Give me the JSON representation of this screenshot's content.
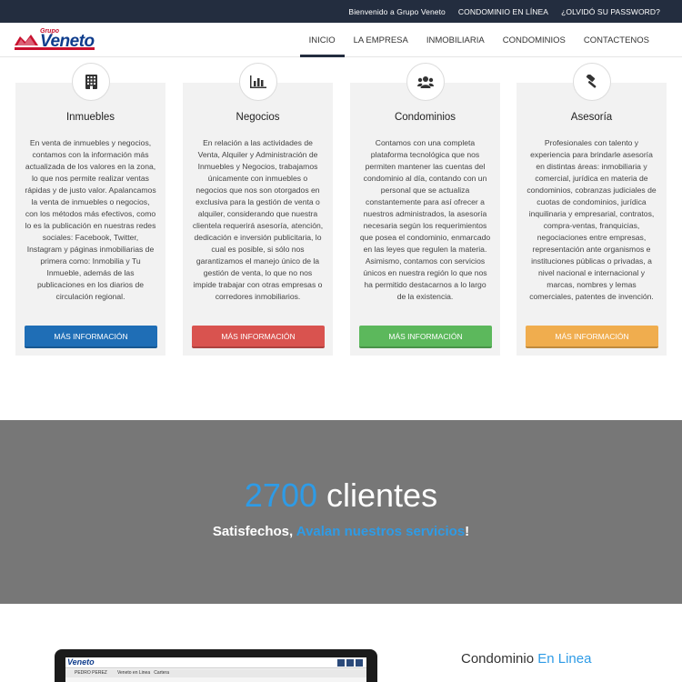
{
  "topbar": {
    "welcome": "Bienvenido a Grupo Veneto",
    "condominio": "CONDOMINIO EN LÍNEA",
    "forgot": "¿OLVIDÓ SU PASSWORD?"
  },
  "logo": {
    "small": "Grupo",
    "brand": "Veneto"
  },
  "nav": [
    {
      "label": "INICIO",
      "active": true
    },
    {
      "label": "LA EMPRESA"
    },
    {
      "label": "INMOBILIARIA"
    },
    {
      "label": "CONDOMINIOS"
    },
    {
      "label": "CONTACTENOS"
    }
  ],
  "cards": [
    {
      "icon": "building-icon",
      "title": "Inmuebles",
      "text": "En venta de inmuebles y negocios, contamos con la información más actualizada de los valores en la zona, lo que nos permite realizar ventas rápidas y de justo valor. Apalancamos la venta de inmuebles o negocios, con los métodos más efectivos, como lo es la publicación en nuestras redes sociales: Facebook, Twitter, Instagram y páginas inmobiliarias de primera como: Inmobilia y Tu Inmueble, además de las publicaciones en los diarios de circulación regional.",
      "button": "MÁS INFORMACIÓN",
      "color": "#1f6eb6"
    },
    {
      "icon": "bar-chart-icon",
      "title": "Negocios",
      "text": "En relación a las actividades de Venta, Alquiler y Administración de Inmuebles y Negocios, trabajamos únicamente con inmuebles o negocios que nos son otorgados en exclusiva para la gestión de venta o alquiler, considerando que nuestra clientela requerirá asesoría, atención, dedicación e inversión publicitaria, lo cual es posible, si sólo nos garantizamos el manejo único de la gestión de venta, lo que no nos impide trabajar con otras empresas o corredores inmobiliarios.",
      "button": "MÁS INFORMACIÓN",
      "color": "#d9534f"
    },
    {
      "icon": "users-icon",
      "title": "Condominios",
      "text": "Contamos con una completa plataforma tecnológica que nos permiten mantener las cuentas del condominio al día, contando con un personal que se actualiza constantemente para así ofrecer a nuestros administrados, la asesoría necesaria según los requerimientos que posea el condominio, enmarcado en las leyes que regulen la materia. Asimismo, contamos con servicios únicos en nuestra región lo que nos ha permitido destacarnos a lo largo de la existencia.",
      "button": "MÁS INFORMACIÓN",
      "color": "#5cb85c"
    },
    {
      "icon": "gavel-icon",
      "title": "Asesoría",
      "text": "Profesionales con talento y experiencia para brindarle asesoría en distintas áreas: inmobiliaria y comercial, jurídica en materia de condominios, cobranzas judiciales de cuotas de condominios, jurídica inquilinaria y empresarial, contratos, compra-ventas, franquicias, negociaciones entre empresas, representación ante organismos e instituciones públicas o privadas, a nivel nacional e internacional y marcas, nombres y lemas comerciales, patentes de invención.",
      "button": "MÁS INFORMACIÓN",
      "color": "#f0ad4e"
    }
  ],
  "band": {
    "number": "2700",
    "word": " clientes",
    "sub_prefix": "Satisfechos, ",
    "sub_highlight": "Avalan nuestros servicios",
    "sub_suffix": "!"
  },
  "bottom": {
    "title_prefix": "Condominio ",
    "title_highlight": "En Linea",
    "screen_logo": "Veneto",
    "screen_user": "PEDRO PEREZ",
    "screen_tab1": "Veneto en Linea",
    "screen_tab2": "Cartera"
  }
}
